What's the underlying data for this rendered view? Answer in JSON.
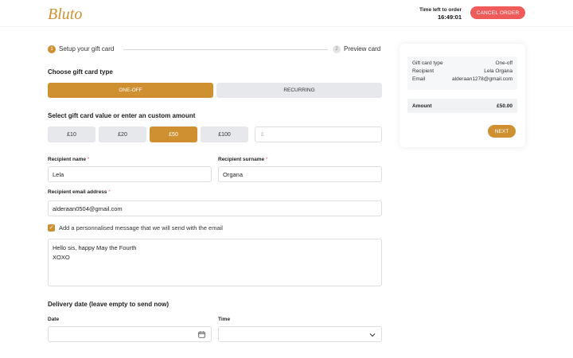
{
  "brand": {
    "logo_text": "Bluto",
    "accent": "#cf9032",
    "danger": "#ef5a5a"
  },
  "header": {
    "timer_label": "Time left to order",
    "timer_value": "16:49:01",
    "cancel_label": "CANCEL ORDER"
  },
  "stepper": {
    "steps": [
      {
        "number": "1",
        "label": "Setup your gift card",
        "active": true
      },
      {
        "number": "2",
        "label": "Preview card",
        "active": false
      }
    ]
  },
  "card_type": {
    "title": "Choose gift card type",
    "options": [
      "ONE-OFF",
      "RECURRING"
    ],
    "selected": "ONE-OFF"
  },
  "amount": {
    "title": "Select gift card value or enter an custom amount",
    "options": [
      "£10",
      "£20",
      "£50",
      "£100"
    ],
    "selected": "£50",
    "custom_placeholder": "£"
  },
  "recipient": {
    "name_label": "Recipient name",
    "name_value": "Lela",
    "surname_label": "Recipient surname",
    "surname_value": "Organa",
    "email_label": "Recipient email address",
    "email_value": "alderaan0504@gmail.com",
    "required_mark": "*"
  },
  "message": {
    "checkbox_label": "Add a personnalised message that we will send with the email",
    "checked": true,
    "lines": [
      "Hello sis, happy May the Fourth",
      "XOXO"
    ]
  },
  "delivery": {
    "title": "Delivery date (leave empty to send now)",
    "date_label": "Date",
    "time_label": "Time",
    "date_value": "",
    "time_value": ""
  },
  "summary": {
    "rows": [
      {
        "key": "Gift card type",
        "value": "One-off"
      },
      {
        "key": "Recipient",
        "value": "Lela Organa"
      },
      {
        "key": "Email",
        "value": "alderaan1278@gmail.com"
      }
    ],
    "amount_label": "Amount",
    "amount_value": "£50.00",
    "next_label": "NEXT"
  }
}
